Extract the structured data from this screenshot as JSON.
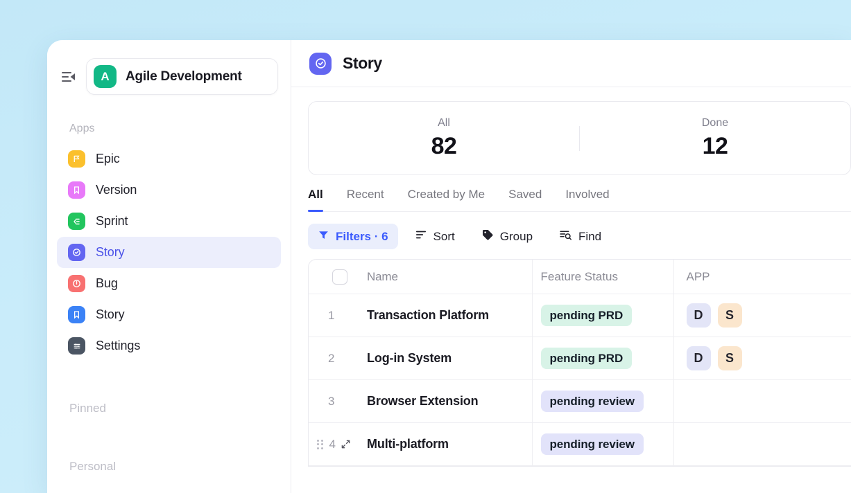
{
  "sidebar": {
    "collapse_icon": "collapse-sidebar-icon",
    "workspace": {
      "initial": "A",
      "name": "Agile Development",
      "color": "#12b886"
    },
    "apps_label": "Apps",
    "items": [
      {
        "label": "Epic",
        "icon": "flag-icon",
        "color": "#fbc02d",
        "active": false
      },
      {
        "label": "Version",
        "icon": "bookmark-icon",
        "color": "#e879f9",
        "active": false
      },
      {
        "label": "Sprint",
        "icon": "sprint-icon",
        "color": "#22c55e",
        "active": false
      },
      {
        "label": "Story",
        "icon": "check-circle-icon",
        "color": "#6366f1",
        "active": true
      },
      {
        "label": "Bug",
        "icon": "alert-circle-icon",
        "color": "#f87171",
        "active": false
      },
      {
        "label": "Story",
        "icon": "bookmark-icon",
        "color": "#3b82f6",
        "active": false
      },
      {
        "label": "Settings",
        "icon": "sliders-icon",
        "color": "#4b5563",
        "active": false
      }
    ],
    "pinned_label": "Pinned",
    "personal_label": "Personal"
  },
  "header": {
    "icon": "check-circle-icon",
    "icon_color": "#6366f1",
    "title": "Story"
  },
  "stats": [
    {
      "label": "All",
      "value": "82"
    },
    {
      "label": "Done",
      "value": "12"
    }
  ],
  "tabs": [
    {
      "label": "All",
      "active": true
    },
    {
      "label": "Recent",
      "active": false
    },
    {
      "label": "Created by Me",
      "active": false
    },
    {
      "label": "Saved",
      "active": false
    },
    {
      "label": "Involved",
      "active": false
    }
  ],
  "toolbar": [
    {
      "label": "Filters · 6",
      "icon": "filter-icon",
      "active": true
    },
    {
      "label": "Sort",
      "icon": "sort-icon",
      "active": false
    },
    {
      "label": "Group",
      "icon": "tag-icon",
      "active": false
    },
    {
      "label": "Find",
      "icon": "find-icon",
      "active": false
    }
  ],
  "table": {
    "columns": {
      "name": "Name",
      "feature_status": "Feature Status",
      "app": "APP"
    },
    "rows": [
      {
        "index": "1",
        "name": "Transaction Platform",
        "status": "pending PRD",
        "status_style": "green",
        "apps": [
          {
            "label": "D",
            "style": "lav"
          },
          {
            "label": "S",
            "style": "peach"
          }
        ],
        "hover": false
      },
      {
        "index": "2",
        "name": "Log-in System",
        "status": "pending PRD",
        "status_style": "green",
        "apps": [
          {
            "label": "D",
            "style": "lav"
          },
          {
            "label": "S",
            "style": "peach"
          }
        ],
        "hover": false
      },
      {
        "index": "3",
        "name": "Browser Extension",
        "status": "pending review",
        "status_style": "violet",
        "apps": [],
        "hover": false
      },
      {
        "index": "4",
        "name": "Multi-platform",
        "status": "pending review",
        "status_style": "violet",
        "apps": [],
        "hover": true
      }
    ]
  },
  "theme": {
    "accent": "#3b5bfd",
    "active_nav_bg": "#eceefc",
    "background": "#c9ecfa"
  }
}
